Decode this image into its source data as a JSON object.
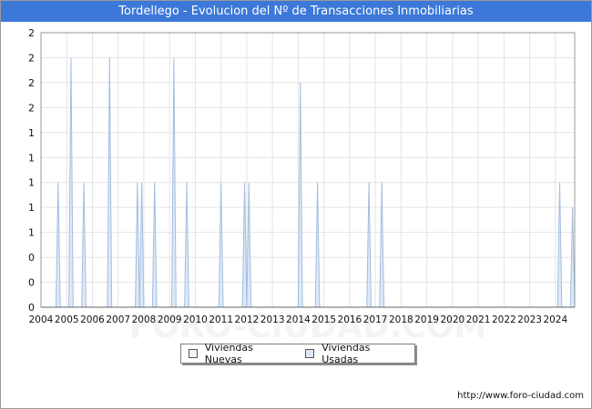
{
  "chart_data": {
    "type": "area",
    "title": "Tordellego - Evolucion del Nº de Transacciones Inmobiliarias",
    "xlabel": "",
    "ylabel": "",
    "x_ticks": [
      "2004",
      "2005",
      "2006",
      "2007",
      "2008",
      "2009",
      "2010",
      "2011",
      "2012",
      "2013",
      "2014",
      "2015",
      "2016",
      "2017",
      "2018",
      "2019",
      "2020",
      "2021",
      "2022",
      "2023",
      "2024"
    ],
    "y_ticks": [
      "0",
      "0",
      "0",
      "1",
      "1",
      "1",
      "1",
      "1",
      "2",
      "2",
      "2",
      "2"
    ],
    "ylim": [
      0,
      2.2
    ],
    "x_range": [
      "2004-01",
      "2024-10"
    ],
    "grid": true,
    "legend_position": "bottom-center",
    "series": [
      {
        "name": "Viviendas Nuevas",
        "color": "#f2f2f2",
        "border": "#555555",
        "points": []
      },
      {
        "name": "Viviendas Usadas",
        "color": "#dde9f7",
        "line_color": "#a3bde0",
        "points": [
          {
            "x": "2004-09",
            "y": 1
          },
          {
            "x": "2005-03",
            "y": 2
          },
          {
            "x": "2005-09",
            "y": 1
          },
          {
            "x": "2006-09",
            "y": 2
          },
          {
            "x": "2007-10",
            "y": 1
          },
          {
            "x": "2007-12",
            "y": 1
          },
          {
            "x": "2008-06",
            "y": 1
          },
          {
            "x": "2009-03",
            "y": 2
          },
          {
            "x": "2009-09",
            "y": 1
          },
          {
            "x": "2011-01",
            "y": 1
          },
          {
            "x": "2011-12",
            "y": 1
          },
          {
            "x": "2012-02",
            "y": 1
          },
          {
            "x": "2014-02",
            "y": 1.8
          },
          {
            "x": "2014-10",
            "y": 1
          },
          {
            "x": "2016-10",
            "y": 1
          },
          {
            "x": "2017-04",
            "y": 1
          },
          {
            "x": "2024-03",
            "y": 1
          },
          {
            "x": "2024-09",
            "y": 0.8
          }
        ]
      }
    ]
  },
  "footer": {
    "source": "http://www.foro-ciudad.com"
  },
  "watermark": "FORO-CIUDAD.COM"
}
